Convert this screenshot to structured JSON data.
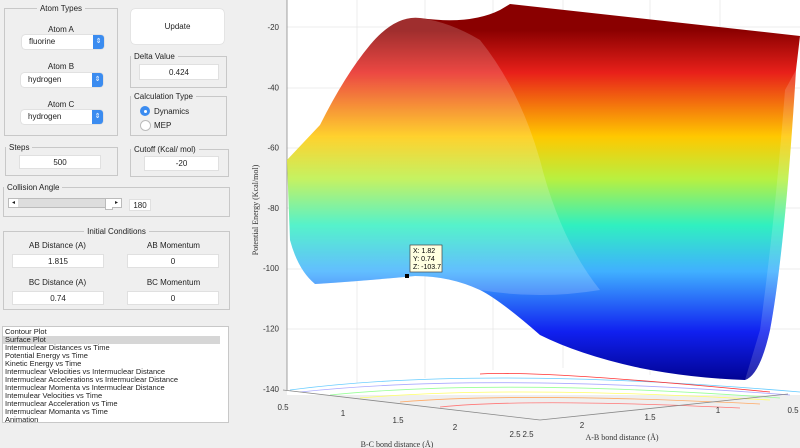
{
  "atom_types": {
    "title": "Atom Types",
    "atom_a": {
      "label": "Atom A",
      "value": "fluorine"
    },
    "atom_b": {
      "label": "Atom B",
      "value": "hydrogen"
    },
    "atom_c": {
      "label": "Atom C",
      "value": "hydrogen"
    }
  },
  "update_label": "Update",
  "delta": {
    "title": "Delta Value",
    "value": "0.424"
  },
  "calc_type": {
    "title": "Calculation Type",
    "options": [
      "Dynamics",
      "MEP"
    ],
    "selected": "Dynamics"
  },
  "steps": {
    "title": "Steps",
    "value": "500"
  },
  "cutoff": {
    "title": "Cutoff (Kcal/ mol)",
    "value": "-20"
  },
  "collision": {
    "title": "Collision Angle",
    "value": "180",
    "slider_fraction": 1.0
  },
  "initial": {
    "title": "Initial Conditions",
    "ab_distance": {
      "label": "AB Distance (A)",
      "value": "1.815"
    },
    "ab_momentum": {
      "label": "AB Momentum",
      "value": "0"
    },
    "bc_distance": {
      "label": "BC Distance (A)",
      "value": "0.74"
    },
    "bc_momentum": {
      "label": "BC Momentum",
      "value": "0"
    }
  },
  "plot_list": {
    "items": [
      "Contour Plot",
      "Surface Plot",
      "Intermuclear Distances vs Time",
      "Potential Energy vs Time",
      "Kinetic Energy vs Time",
      "Intermuclear Velocities vs Intermuclear Distance",
      "Intermuclear Accelerations vs Intermuclear Distance",
      "Intermuclear Momenta vs Intermuclear Distance",
      "Intemulear Velocities vs Time",
      "Intermuclear Acceleration vs Time",
      "Intermuclear Momanta vs Time",
      "Animation"
    ],
    "selected": "Surface Plot"
  },
  "plot": {
    "zlabel": "Potential Energy (Kcal/mol)",
    "xlabel": "A-B bond distance (Å)",
    "ylabel": "B-C bond distance (Å)",
    "z_ticks": [
      "-20",
      "-40",
      "-60",
      "-80",
      "-100",
      "-120",
      "-140"
    ],
    "bc_ticks": [
      "0.5",
      "1",
      "1.5",
      "2",
      "2.5"
    ],
    "ab_ticks": [
      "2.5",
      "2",
      "1.5",
      "1",
      "0.5"
    ],
    "colormap": "jet",
    "datatip": {
      "x": "X: 1.82",
      "y": "Y: 0.74",
      "z": "Z: -103.7"
    }
  }
}
